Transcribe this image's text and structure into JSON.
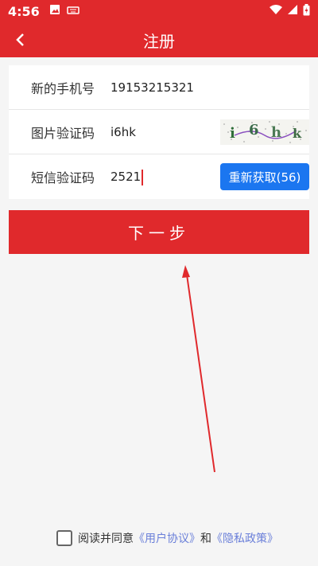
{
  "status_bar": {
    "time": "4:56"
  },
  "app_bar": {
    "title": "注册"
  },
  "form": {
    "phone": {
      "label": "新的手机号",
      "value": "19153215321"
    },
    "image_code": {
      "label": "图片验证码",
      "value": "i6hk",
      "captcha_text": "i 6 h k"
    },
    "sms_code": {
      "label": "短信验证码",
      "value": "2521",
      "resend_label": "重新获取(56)"
    }
  },
  "next_button": {
    "label": "下一步"
  },
  "agreement": {
    "text": "阅读并同意",
    "user_agreement": "《用户协议》",
    "and": "和",
    "privacy_policy": "《隐私政策》",
    "checked": false
  },
  "colors": {
    "primary": "#e0292c",
    "accent_blue": "#1b76f0",
    "link": "#6a7fd9"
  }
}
